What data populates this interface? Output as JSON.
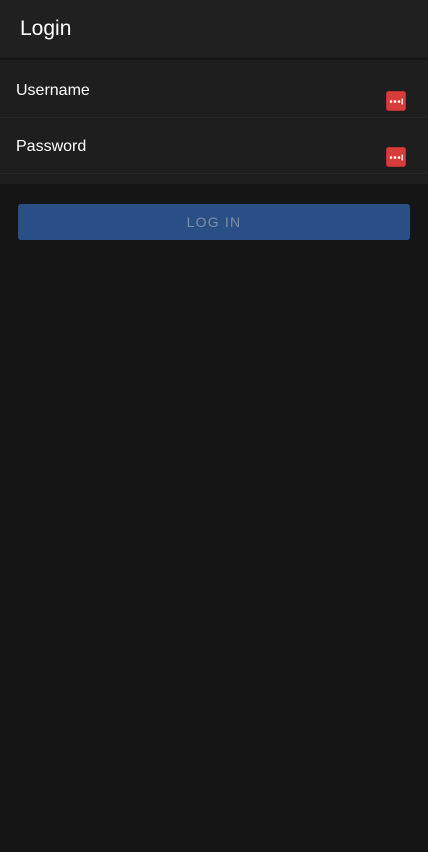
{
  "header": {
    "title": "Login"
  },
  "form": {
    "username": {
      "label": "Username",
      "value": "",
      "icon": "password-manager-icon"
    },
    "password": {
      "label": "Password",
      "value": "",
      "icon": "password-manager-icon"
    }
  },
  "actions": {
    "login_label": "LOG IN"
  },
  "colors": {
    "background": "#151515",
    "header": "#202020",
    "form": "#1e1e1e",
    "primary_button": "#2a4f86",
    "password_manager_icon": "#d63c3c"
  }
}
